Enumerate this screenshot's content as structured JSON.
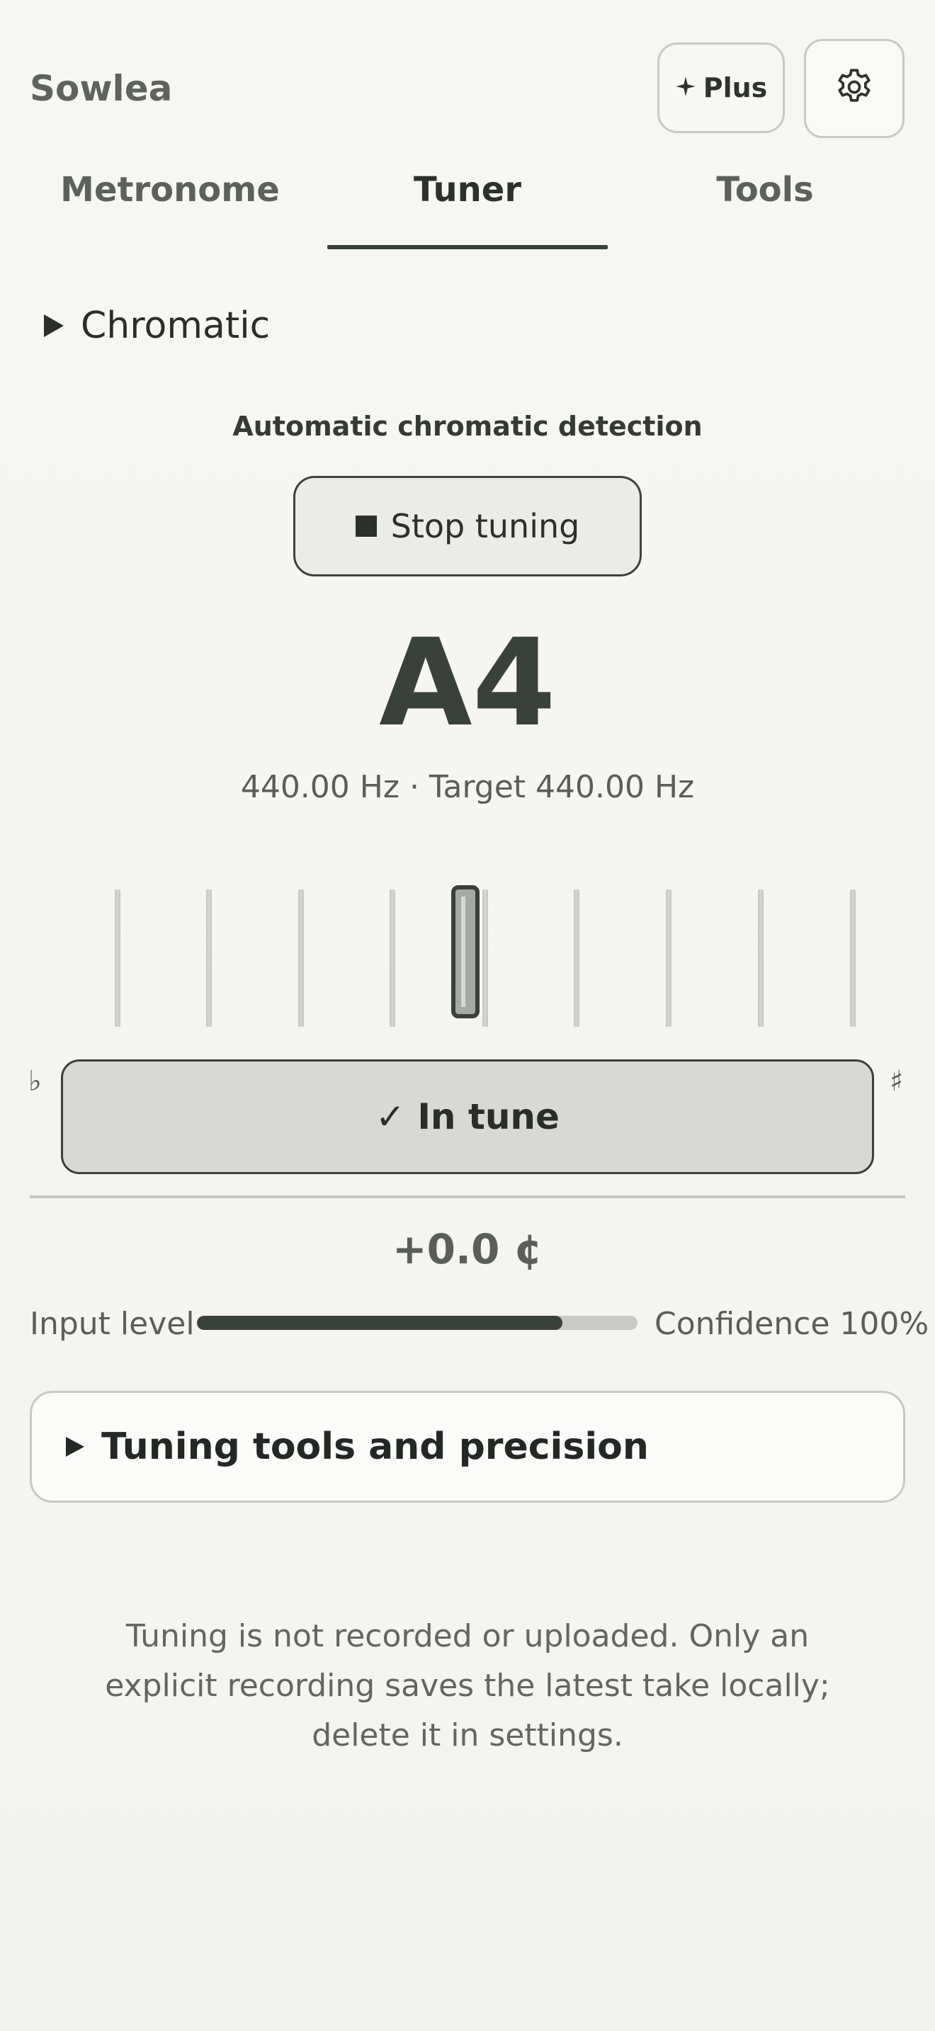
{
  "header": {
    "brand": "Sowlea",
    "plus_label": "Plus",
    "plus_icon": "sparkle-icon",
    "settings_icon": "gear-icon"
  },
  "tabs": [
    {
      "label": "Metronome",
      "active": false
    },
    {
      "label": "Tuner",
      "active": true
    },
    {
      "label": "Tools",
      "active": false
    }
  ],
  "mode": {
    "label": "Chromatic",
    "expanded": false
  },
  "tuner": {
    "detection_title": "Automatic chromatic detection",
    "stop_label": "Stop tuning",
    "note": "A4",
    "frequency_text": "440.00 Hz · Target 440.00 Hz",
    "flat_symbol": "♭",
    "sharp_symbol": "♯",
    "status": "✓ In tune",
    "cents": "+0.0 ¢",
    "input_level_label": "Input level",
    "input_level": 0.83,
    "confidence": "Confidence 100%"
  },
  "tools_panel": {
    "label": "Tuning tools and precision",
    "expanded": false
  },
  "privacy_note": "Tuning is not recorded or uploaded. Only an explicit recording saves the latest take locally; delete it in settings.",
  "colors": {
    "accent": "#3a403b",
    "background": "#f5f5f2",
    "status_fill": "#d8d8d6"
  }
}
